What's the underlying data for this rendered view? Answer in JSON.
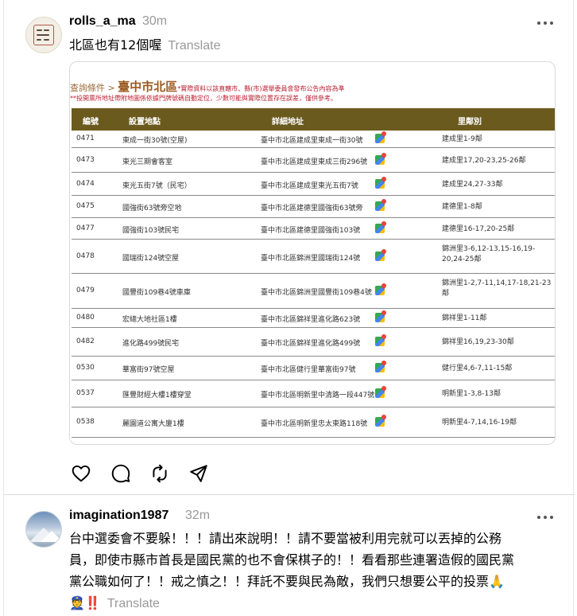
{
  "post1": {
    "username": "rolls_a_ma",
    "time": "30m",
    "text": "北區也有12個喔",
    "translate": "Translate",
    "embed": {
      "crumb_prefix": "查詢條件 > ",
      "crumb_title": "臺中市北區",
      "crumb_note": "*實際資料以該直轄市、縣(市)選舉委員會發布公告內容為準",
      "subnote": "**投開票所地址帶附地圖係依據門牌號碼自動定位，少數可能與實際位置存在誤差，僅供參考。",
      "headers": [
        "編號",
        "設置地點",
        "詳細地址",
        "里鄰別"
      ],
      "rows": [
        {
          "id": "0471",
          "place": "東成一街30號(空屋)",
          "addr": "臺中市北區建成里東成一街30號",
          "li": "建成里1-9鄰"
        },
        {
          "id": "0473",
          "place": "東光三期會客室",
          "addr": "臺中市北區建成里東成三街296號",
          "li": "建成里17,20-23,25-26鄰"
        },
        {
          "id": "0474",
          "place": "東光五街7號（民宅）",
          "addr": "臺中市北區建成里東光五街7號",
          "li": "建成里24,27-33鄰"
        },
        {
          "id": "0475",
          "place": "國強街63號旁空地",
          "addr": "臺中市北區建德里國強街63號旁",
          "li": "建德里1-8鄰"
        },
        {
          "id": "0477",
          "place": "國強街103號民宅",
          "addr": "臺中市北區建德里國強街103號",
          "li": "建德里16-17,20-25鄰"
        },
        {
          "id": "0478",
          "place": "國瑞街124號空屋",
          "addr": "臺中市北區錦洲里國瑞街124號",
          "li": "錦洲里3-6,12-13,15-16,19-20,24-25鄰"
        },
        {
          "id": "0479",
          "place": "國豐街109巷4號車庫",
          "addr": "臺中市北區錦洲里國豐街109巷4號",
          "li": "錦洲里1-2,7-11,14,17-18,21-23鄰"
        },
        {
          "id": "0480",
          "place": "宏總大地社區1樓",
          "addr": "臺中市北區錦祥里進化路623號",
          "li": "錦祥里1-11鄰"
        },
        {
          "id": "0482",
          "place": "進化路499號民宅",
          "addr": "臺中市北區錦祥里進化路499號",
          "li": "錦祥里16,19,23-30鄰"
        },
        {
          "id": "0530",
          "place": "華富街97號空屋",
          "addr": "臺中市北區健行里華富街97號",
          "li": "健行里4,6-7,11-15鄰"
        },
        {
          "id": "0537",
          "place": "匯豐財經大樓1樓穿堂",
          "addr": "臺中市北區明新里中清路一段447號",
          "li": "明新里1-3,8-13鄰"
        },
        {
          "id": "0538",
          "place": "麗園道公寓大廈1樓",
          "addr": "臺中市北區明新里忠太東路118號",
          "li": "明新里4-7,14,16-19鄰"
        }
      ]
    },
    "icons": [
      "heart-icon",
      "comment-icon",
      "repost-icon",
      "share-icon"
    ]
  },
  "post2": {
    "username": "imagination1987",
    "time": "32m",
    "line1": "台中選委會不要躲！！！請出來說明！！請不要當被利用完就可以丟掉的公務",
    "line2": "員，即使市縣市首長是國民黨的也不會保棋子的！！看看那些連署造假的國民黨",
    "line3": "黨公職如何了！！戒之慎之！！拜託不要與民為敵，我們只想要公平的投票",
    "emoji_pray": "🙏",
    "emoji_police": "👮",
    "emoji_exclaim": "‼️",
    "translate": "Translate"
  },
  "colors": {
    "header_bg": "#6b5a1e",
    "muted": "#999999",
    "accent_red": "#b22233"
  }
}
